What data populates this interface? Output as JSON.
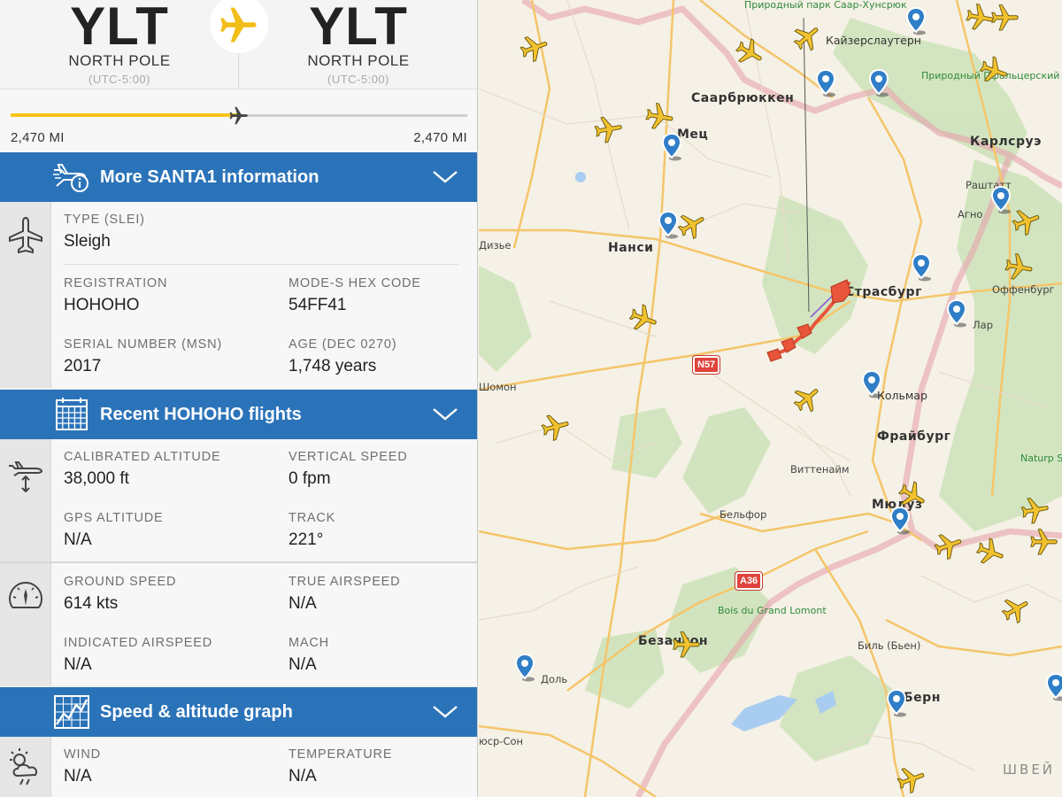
{
  "route": {
    "origin": {
      "code": "YLT",
      "city": "NORTH POLE",
      "utc": "(UTC-5:00)"
    },
    "destination": {
      "code": "YLT",
      "city": "NORTH POLE",
      "utc": "(UTC-5:00)"
    },
    "progress": 0.5,
    "distance_flown": "2,470 MI",
    "distance_remaining": "2,470 MI"
  },
  "sections": {
    "more_info": "More SANTA1 information",
    "recent_flights": "Recent HOHOHO flights",
    "graph": "Speed & altitude graph"
  },
  "aircraft": {
    "type_label": "TYPE (SLEI)",
    "type_value": "Sleigh",
    "registration_label": "REGISTRATION",
    "registration_value": "HOHOHO",
    "hex_label": "MODE-S HEX CODE",
    "hex_value": "54FF41",
    "serial_label": "SERIAL NUMBER (MSN)",
    "serial_value": "2017",
    "age_label": "AGE (DEC 0270)",
    "age_value": "1,748 years"
  },
  "altitude": {
    "cal_alt_label": "CALIBRATED ALTITUDE",
    "cal_alt_value": "38,000 ft",
    "vs_label": "VERTICAL SPEED",
    "vs_value": "0 fpm",
    "gps_alt_label": "GPS ALTITUDE",
    "gps_alt_value": "N/A",
    "track_label": "TRACK",
    "track_value": "221°"
  },
  "speed": {
    "gs_label": "GROUND SPEED",
    "gs_value": "614 kts",
    "tas_label": "TRUE AIRSPEED",
    "tas_value": "N/A",
    "ias_label": "INDICATED AIRSPEED",
    "ias_value": "N/A",
    "mach_label": "MACH",
    "mach_value": "N/A"
  },
  "weather": {
    "wind_label": "WIND",
    "wind_value": "N/A",
    "temp_label": "TEMPERATURE",
    "temp_value": "N/A"
  },
  "map": {
    "cities": {
      "saarbrucken": "Саарбрюккен",
      "kaiserslautern": "Кайзерслаутерн",
      "metz": "Мец",
      "nancy": "Нанси",
      "strasbourg": "Страсбург",
      "karlsruhe": "Карлсруэ",
      "rastatt": "Раштатт",
      "agno": "Агно",
      "offenburg": "Оффенбург",
      "lahr": "Лар",
      "colmar": "Кольмар",
      "freiburg": "Фрайбург",
      "wittenheim": "Виттенайм",
      "mulhouse": "Мюлуз",
      "belfort": "Бельфор",
      "besancon": "Безансон",
      "dole": "Доль",
      "biel": "Биль (Бьен)",
      "bern": "Берн",
      "chaumont": "Шомон",
      "dizier": "Дизье",
      "lons": "юср-Сон",
      "switzerland": "ШВЕЙ"
    },
    "parks": {
      "saar_park": "Природный парк Саар-Хунсрюк",
      "pfalz_park": "Природный Пфальцерский вальд",
      "bois_du": "Bois du Grand Lomont",
      "natur_sud": "Naturp Südsc"
    },
    "roads": {
      "n57": "N57",
      "a36": "A36"
    },
    "colors": {
      "flight_trail": "#e8553a",
      "aircraft": "#f2c22e",
      "marker": "#2f7ec7"
    }
  }
}
